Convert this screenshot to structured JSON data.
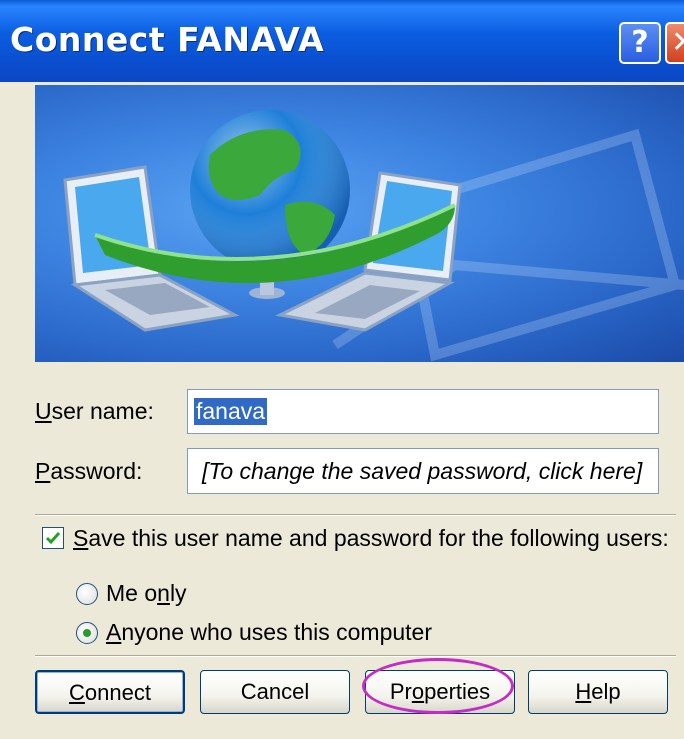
{
  "window": {
    "title": "Connect FANAVA",
    "help_glyph": "?",
    "close_glyph": "✕"
  },
  "form": {
    "username_label": {
      "mn": "U",
      "rest": "ser name:"
    },
    "username_value": "fanava",
    "password_label": {
      "mn": "P",
      "rest": "assword:"
    },
    "password_value": "[To change the saved password, click here]",
    "save_checked": true,
    "save_label": {
      "mn": "S",
      "rest": "ave this user name and password for the following users:"
    },
    "options": [
      {
        "pre": "Me o",
        "mn": "n",
        "post": "ly",
        "selected": false
      },
      {
        "pre": "",
        "mn": "A",
        "post": "nyone who uses this computer",
        "selected": true
      }
    ]
  },
  "buttons": {
    "connect": {
      "mn": "C",
      "rest": "onnect"
    },
    "cancel": "Cancel",
    "properties": {
      "pre": "Pr",
      "mn": "o",
      "post": "perties"
    },
    "help": {
      "mn": "H",
      "rest": "elp"
    }
  },
  "colors": {
    "titlebar": "#0a5ed6",
    "highlight_ring": "#c32cc6",
    "selection": "#316ac5"
  },
  "icons": [
    "globe-icon",
    "laptop-icon",
    "help-icon",
    "close-icon",
    "checkmark-icon"
  ]
}
